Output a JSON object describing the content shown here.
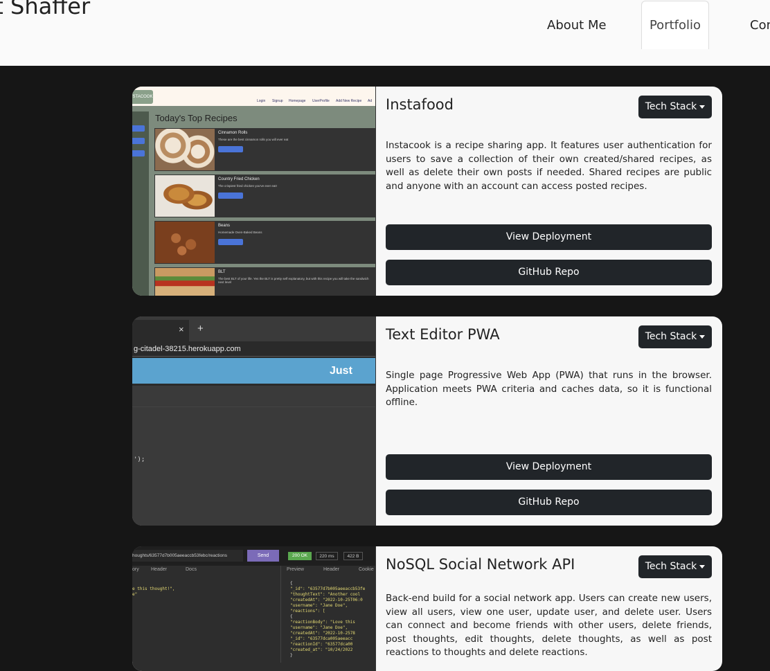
{
  "header": {
    "site_title": "nt Shaffer",
    "nav": [
      {
        "label": "About Me"
      },
      {
        "label": "Portfolio"
      },
      {
        "label": "Con"
      }
    ]
  },
  "projects": [
    {
      "title": "Instafood",
      "tech_button": "Tech Stack",
      "description": "Instacook is a recipe sharing app. It features user authentication for users to save a collection of their own created/shared recipes, as well as delete their own posts if needed. Shared recipes are public and anyone with an account can access posted recipes.",
      "deploy_label": "View Deployment",
      "repo_label": "GitHub Repo",
      "screenshot": {
        "logo": "STACOOK",
        "nav_items": [
          "Login",
          "Signup",
          "Homepage",
          "UserProfile",
          "Add New Recipe",
          "Ad"
        ],
        "heading": "Today's Top Recipes",
        "items": [
          {
            "name": "Cinnamon Rolls",
            "sub": "These are the best cinnamon rolls you will ever eat"
          },
          {
            "name": "Country Fried Chicken",
            "sub": "The crispiest fried chicken you've ever eat!"
          },
          {
            "name": "Beans",
            "sub": "Homemade Oven-Baked Beans"
          },
          {
            "name": "BLT",
            "sub": "The best BLT of your life. Yes the BLT is pretty self explanatory, but with this recipe you will take the sandwich next level"
          }
        ],
        "button_label": "Go To Recipe"
      }
    },
    {
      "title": "Text Editor PWA",
      "tech_button": "Tech Stack",
      "description": "Single page Progressive Web App (PWA) that runs in the browser. Application meets PWA criteria and caches data, so it is functional offline.",
      "deploy_label": "View Deployment",
      "repo_label": "GitHub Repo",
      "screenshot": {
        "url": "g-citadel-38215.herokuapp.com",
        "banner": "Just Ano",
        "code_line": "');",
        "close": "×",
        "new_tab": "+"
      }
    },
    {
      "title": "NoSQL Social Network API",
      "tech_button": "Tech Stack",
      "description": "Back-end build for a social network app. Users can create new users, view all users, view one user, update user, and delete user. Users can connect and become friends with other users, delete friends, post thoughts, edit thoughts, delete thoughts, as well as post reactions to thoughts and delete reactions.",
      "screenshot": {
        "url": "houghts/63577d7b005aeeaccb53febc/reactions",
        "send": "Send",
        "status": "200 OK",
        "time": "220 ms",
        "size": "422 B",
        "left_tabs": [
          "ory",
          "Header",
          "Docs"
        ],
        "right_tabs": [
          "Preview",
          "Header",
          "Cookie"
        ],
        "left_code": [
          "e this thought!\",",
          "e\""
        ],
        "right_code": [
          "{",
          "  \"_id\": \"63577d7b005aeeaccb53fe",
          "  \"thoughtText\": \"Another cool",
          "  \"createdAt\": \"2022-10-25T06:0",
          "  \"username\": \"Jane Doe\",",
          "  \"reactions\": [",
          "    {",
          "      \"reactionBody\": \"Love this",
          "      \"username\": \"Jane Doe\",",
          "      \"createdAt\": \"2022-10-2578",
          "      \"_id\": \"63577dca005aeeacc",
          "      \"reactionId\": \"63577dca00",
          "      \"created_at\": \"10/24/2022",
          "    }"
        ]
      }
    }
  ],
  "colors": {
    "page_bg": "#161616",
    "header_bg": "#fafafa",
    "card_bg": "#f7f7f7",
    "button_bg": "#212529"
  }
}
